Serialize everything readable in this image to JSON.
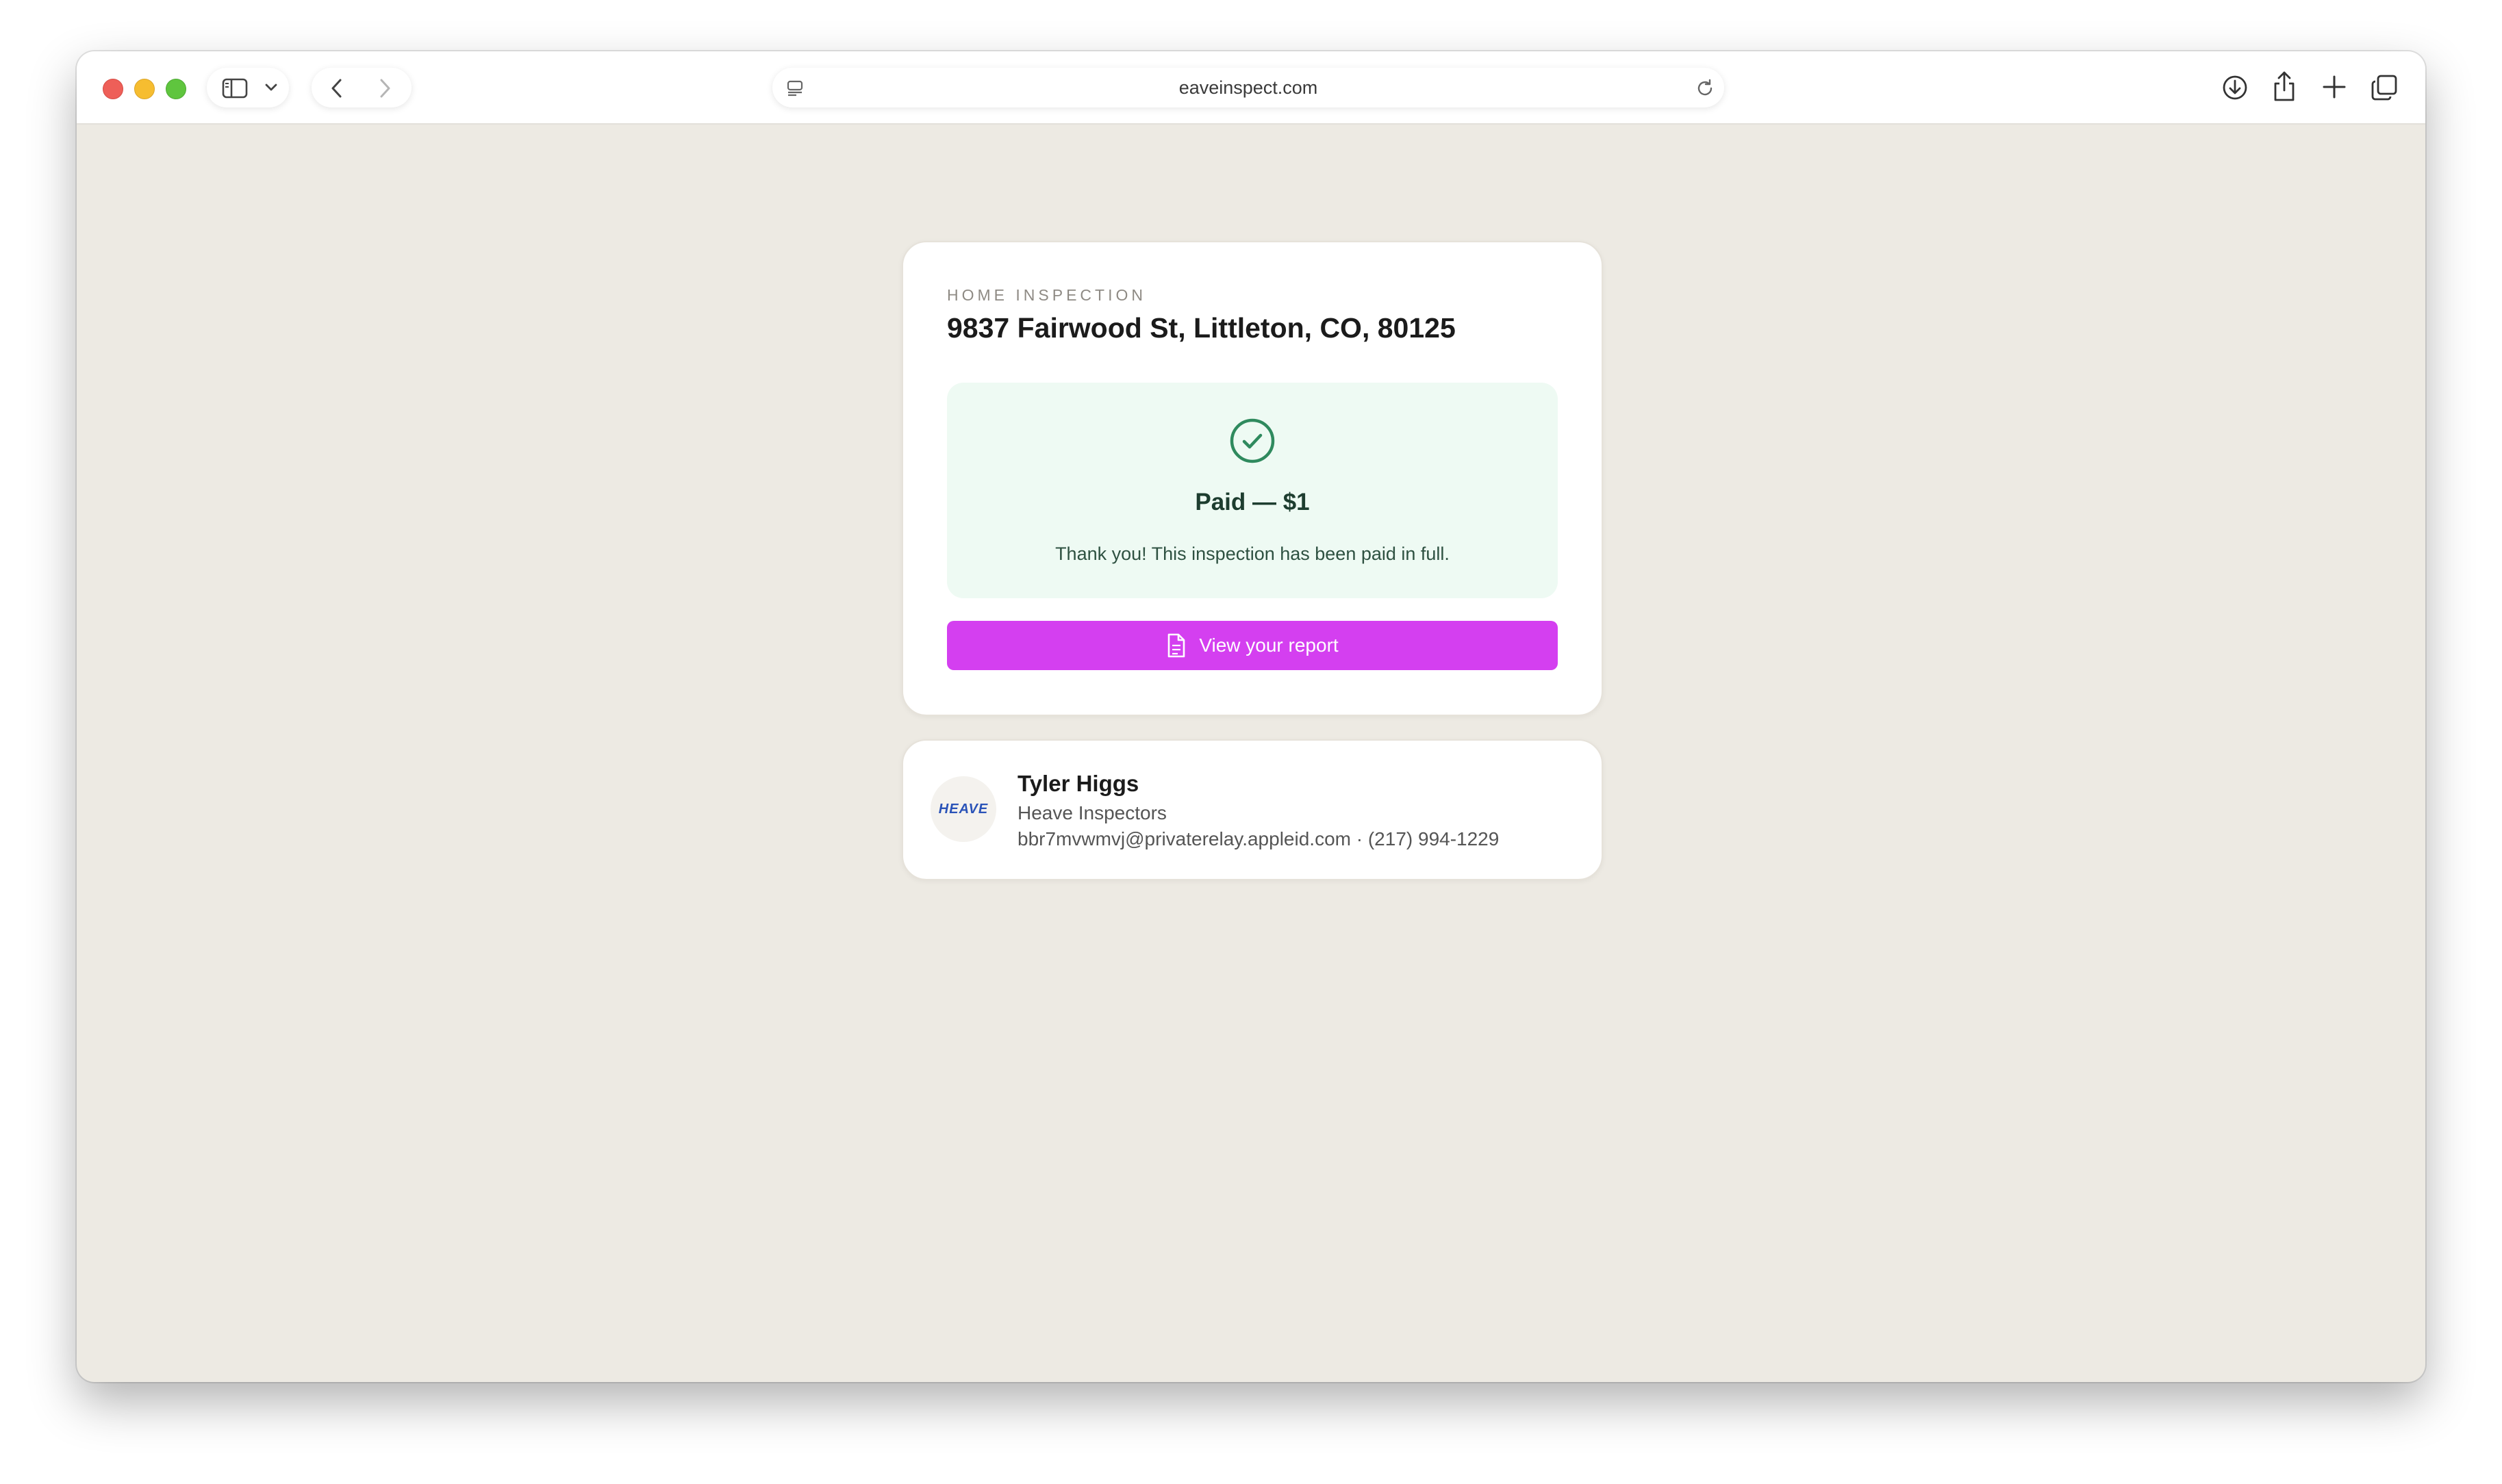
{
  "browser": {
    "url": "eaveinspect.com",
    "icons": {
      "sidebar": "sidebar-icon",
      "sidebar_menu": "chevron-down-icon",
      "back": "chevron-left-icon",
      "forward": "chevron-right-icon",
      "page_menu": "page-menu-icon",
      "reload": "reload-icon",
      "download": "download-icon",
      "share": "share-icon",
      "new_tab": "plus-icon",
      "tabs": "tab-overview-icon"
    }
  },
  "inspection": {
    "eyebrow": "HOME INSPECTION",
    "address": "9837 Fairwood St, Littleton, CO, 80125",
    "payment": {
      "title": "Paid — $1",
      "message": "Thank you! This inspection has been paid in full.",
      "icon": "check-circle-icon"
    },
    "report_button": {
      "label": "View your report",
      "icon": "document-icon"
    }
  },
  "contact": {
    "avatar_text": "HEAVE",
    "name": "Tyler Higgs",
    "company": "Heave Inspectors",
    "email_phone": "bbr7mvwmvj@privaterelay.appleid.com · (217) 994-1229"
  },
  "colors": {
    "accent": "#d43ff0",
    "success_bg": "#eefaf3",
    "success_icon": "#2f8a5e",
    "page_bg": "#edeae3"
  }
}
